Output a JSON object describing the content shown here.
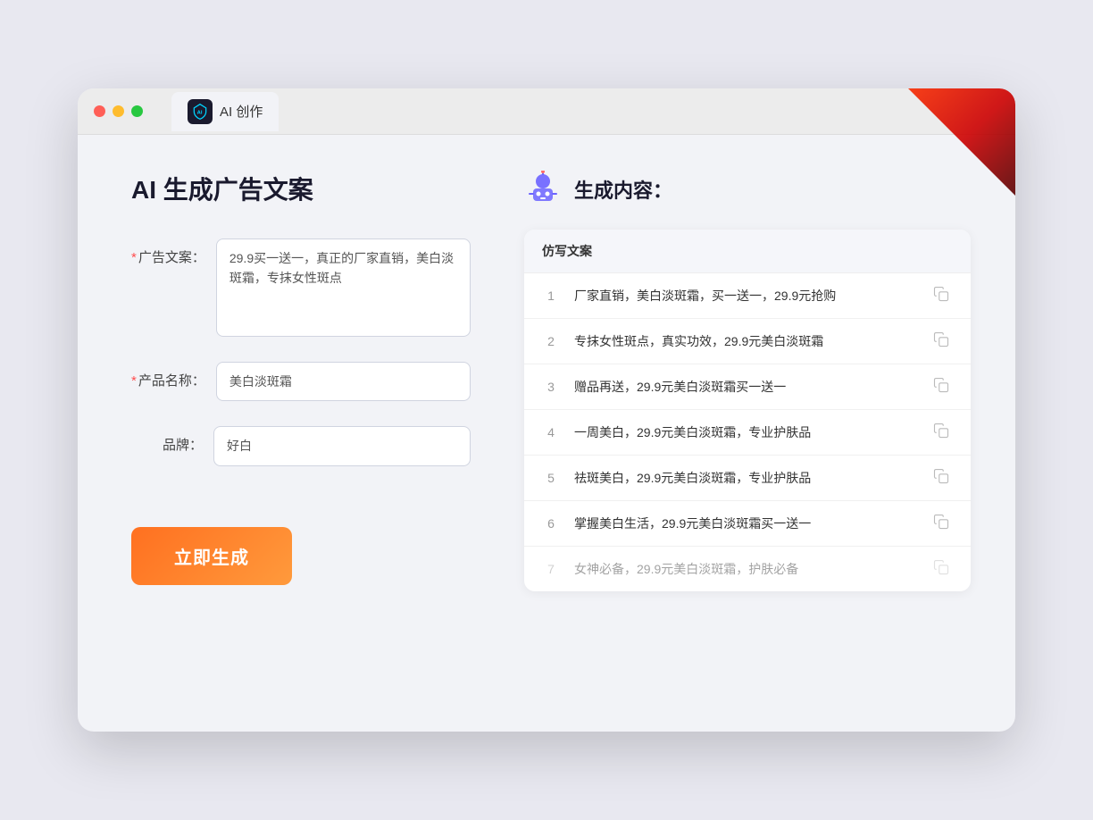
{
  "window": {
    "tab_label": "AI 创作"
  },
  "left": {
    "page_title": "AI 生成广告文案",
    "fields": [
      {
        "label": "广告文案：",
        "required": true,
        "type": "textarea",
        "value": "29.9买一送一，真正的厂家直销，美白淡斑霜，专抹女性斑点",
        "name": "ad-copy-input"
      },
      {
        "label": "产品名称：",
        "required": true,
        "type": "input",
        "value": "美白淡斑霜",
        "name": "product-name-input"
      },
      {
        "label": "品牌：",
        "required": false,
        "type": "input",
        "value": "好白",
        "name": "brand-input"
      }
    ],
    "generate_btn": "立即生成"
  },
  "right": {
    "title": "生成内容：",
    "table_header": "仿写文案",
    "results": [
      {
        "num": "1",
        "text": "厂家直销，美白淡斑霜，买一送一，29.9元抢购"
      },
      {
        "num": "2",
        "text": "专抹女性斑点，真实功效，29.9元美白淡斑霜"
      },
      {
        "num": "3",
        "text": "赠品再送，29.9元美白淡斑霜买一送一"
      },
      {
        "num": "4",
        "text": "一周美白，29.9元美白淡斑霜，专业护肤品"
      },
      {
        "num": "5",
        "text": "祛斑美白，29.9元美白淡斑霜，专业护肤品"
      },
      {
        "num": "6",
        "text": "掌握美白生活，29.9元美白淡斑霜买一送一"
      },
      {
        "num": "7",
        "text": "女神必备，29.9元美白淡斑霜，护肤必备",
        "faded": true
      }
    ]
  }
}
